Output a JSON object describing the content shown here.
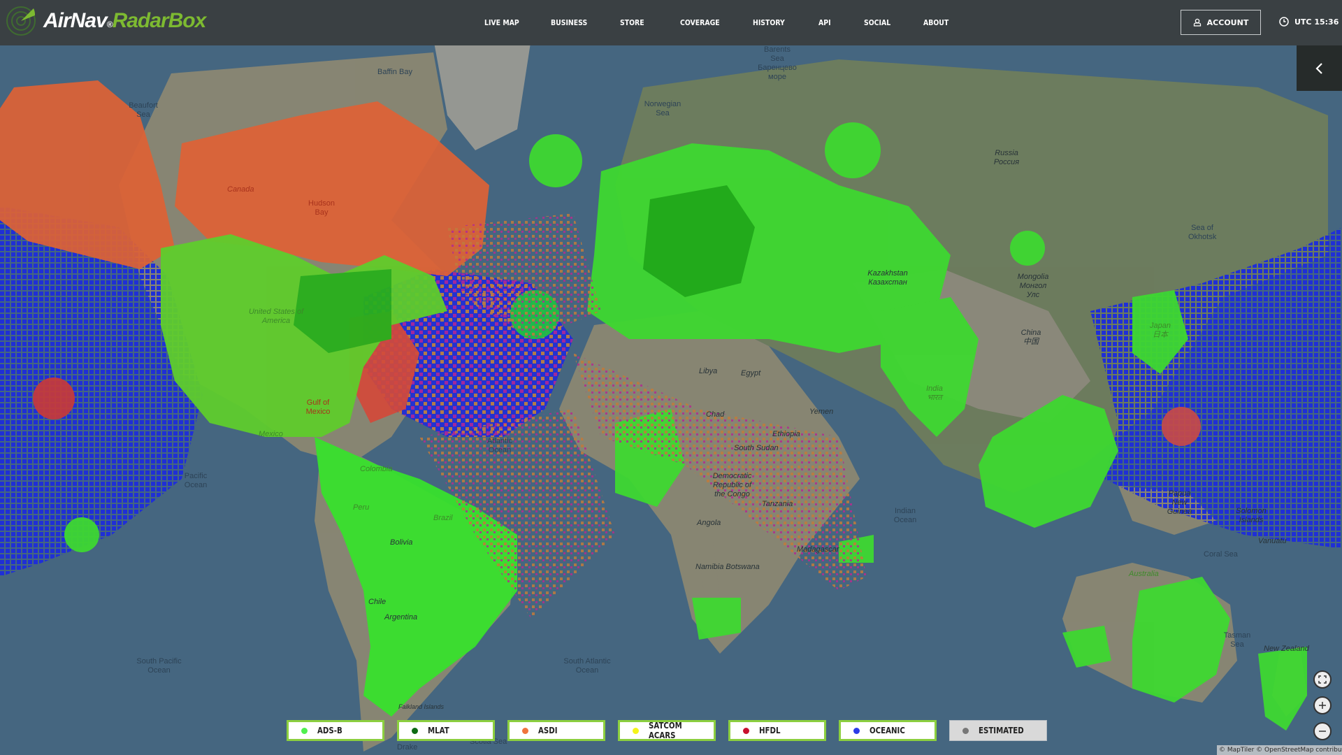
{
  "brand": {
    "name_white": "AirNav",
    "reg": "®",
    "name_green": "RadarBox",
    "accent": "#7dba31"
  },
  "nav": [
    "LIVE MAP",
    "BUSINESS",
    "STORE",
    "COVERAGE",
    "HISTORY",
    "API",
    "SOCIAL",
    "ABOUT"
  ],
  "account_label": "ACCOUNT",
  "clock_label": "UTC 15:36",
  "legend": [
    {
      "label": "ADS-B",
      "color": "#4ff04f",
      "active": true
    },
    {
      "label": "MLAT",
      "color": "#0d6b14",
      "active": true
    },
    {
      "label": "ASDI",
      "color": "#f0743c",
      "active": true
    },
    {
      "label": "SATCOM ACARS",
      "color": "#f4f41a",
      "active": true
    },
    {
      "label": "HFDL",
      "color": "#c8102e",
      "active": true
    },
    {
      "label": "OCEANIC",
      "color": "#2b3be8",
      "active": true
    },
    {
      "label": "ESTIMATED",
      "color": "#777777",
      "active": false
    }
  ],
  "map_labels": {
    "baffin": "Baffin Bay",
    "beaufort": "Beaufort Sea",
    "canada": "Canada",
    "hudson": "Hudson Bay",
    "usa": "United States of America",
    "gulf_mexico": "Gulf of Mexico",
    "mexico": "Mexico",
    "pacific": "Pacific Ocean",
    "south_pacific": "South Pacific Ocean",
    "atlantic": "Atlantic Ocean",
    "south_atlantic": "South Atlantic Ocean",
    "norwegian": "Norwegian Sea",
    "barents": "Barents Sea Баренцево море",
    "russia": "Russia Россия",
    "kazakhstan": "Kazakhstan Казахстан",
    "mongolia": "Mongolia Монгол Улс",
    "china": "China 中国",
    "okhotsk": "Sea of Okhotsk",
    "japan": "Japan 日本",
    "india": "India भारत",
    "libya": "Libya",
    "egypt": "Egypt",
    "chad": "Chad",
    "ethiopia": "Ethiopia",
    "drc": "Democratic Republic of the Congo",
    "tanzania": "Tanzania",
    "angola": "Angola",
    "madagascar": "Madagascar",
    "indian_ocean": "Indian Ocean",
    "australia": "Australia",
    "coral": "Coral Sea",
    "tasman": "Tasman Sea",
    "nz": "New Zealand",
    "png": "Papua New Guinea",
    "solomon": "Solomon Islands",
    "vanuatu": "Vanuatu",
    "brazil": "Brazil",
    "bolivia": "Bolivia",
    "argentina": "Argentina",
    "chile": "Chile",
    "falkland": "Falkland Islands",
    "colombia": "Colombia",
    "peru": "Peru",
    "yemen": "Yemen",
    "sudan": "South Sudan",
    "namibia": "Namibia Botswana",
    "drake": "Drake",
    "scotia": "Scotia Sea"
  },
  "attribution": "© MapTiler © OpenStreetMap contributors"
}
